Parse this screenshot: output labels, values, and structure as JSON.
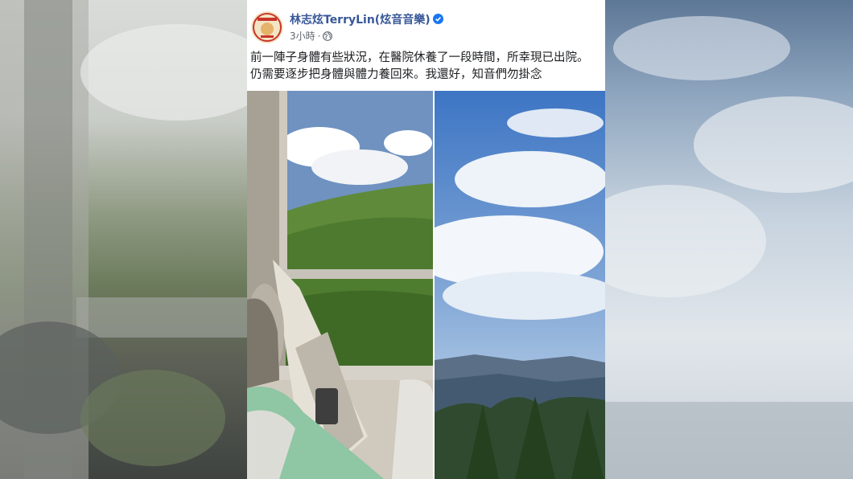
{
  "post": {
    "author": "林志炫TerryLin(炫音音樂)",
    "time": "3小時",
    "separator": "·",
    "verified_icon": "verified-badge-icon",
    "privacy_icon": "globe-icon",
    "text_line1": "前一陣子身體有些狀況，在醫院休養了一段時間，所幸現已出院。",
    "text_line2": "仍需要逐步把身體與體力養回來。我還好，知音們勿掛念"
  },
  "colors": {
    "author": "#385898",
    "verified": "#1877f2",
    "meta": "#616770",
    "text": "#1c1e21"
  }
}
